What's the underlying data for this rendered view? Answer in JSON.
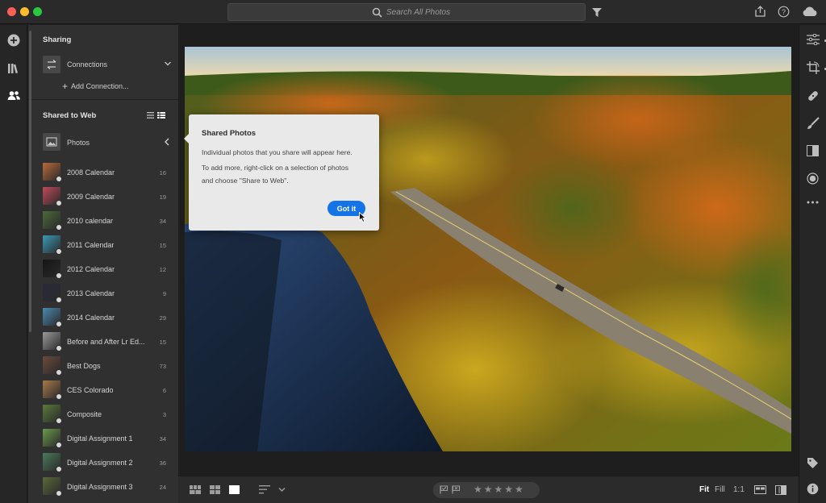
{
  "titlebar": {
    "search_placeholder": "Search All Photos",
    "icons": [
      "search-icon",
      "filter-icon",
      "share-icon",
      "help-icon",
      "cloud-icon"
    ]
  },
  "toolbar_left": {
    "items": [
      "add-photos-icon",
      "my-photos-icon",
      "shared-icon"
    ],
    "active": "shared-icon"
  },
  "sharing": {
    "title": "Sharing",
    "connections_label": "Connections",
    "add_connection_label": "Add Connection..."
  },
  "shared_web": {
    "title": "Shared to Web",
    "photos_label": "Photos",
    "albums": [
      {
        "name": "2008 Calendar",
        "count": "16",
        "color": "#b86a3a"
      },
      {
        "name": "2009 Calendar",
        "count": "19",
        "color": "#c04a5a"
      },
      {
        "name": "2010 calendar",
        "count": "34",
        "color": "#4b6a3a"
      },
      {
        "name": "2011 Calendar",
        "count": "15",
        "color": "#3a9ab5"
      },
      {
        "name": "2012 Calendar",
        "count": "12",
        "color": "#151515"
      },
      {
        "name": "2013 Calendar",
        "count": "9",
        "color": "#2a2a3a"
      },
      {
        "name": "2014 Calendar",
        "count": "29",
        "color": "#4a8ab0"
      },
      {
        "name": "Before and After Lr Ed...",
        "count": "15",
        "color": "#9a9a9a"
      },
      {
        "name": "Best Dogs",
        "count": "73",
        "color": "#6a4a3a"
      },
      {
        "name": "CES Colorado",
        "count": "6",
        "color": "#a87a4a"
      },
      {
        "name": "Composite",
        "count": "3",
        "color": "#5a7a3a"
      },
      {
        "name": "Digital Assignment 1",
        "count": "34",
        "color": "#6a9a4a"
      },
      {
        "name": "Digital Assignment 2",
        "count": "36",
        "color": "#4a7a5a"
      },
      {
        "name": "Digital Assignment 3",
        "count": "24",
        "color": "#5a6a3a"
      }
    ]
  },
  "coach_mark": {
    "title": "Shared Photos",
    "line1": "Individual photos that you share will appear here.",
    "line2": "To add more, right-click on a selection of photos",
    "line3": "and choose \"Share to Web\".",
    "button": "Got it"
  },
  "bottom": {
    "zoom_fit": "Fit",
    "zoom_fill": "Fill",
    "zoom_one": "1:1",
    "stars": "★★★★★"
  },
  "colors": {
    "accent": "#1473e6",
    "panel": "#303030",
    "background": "#1e1e1e"
  }
}
